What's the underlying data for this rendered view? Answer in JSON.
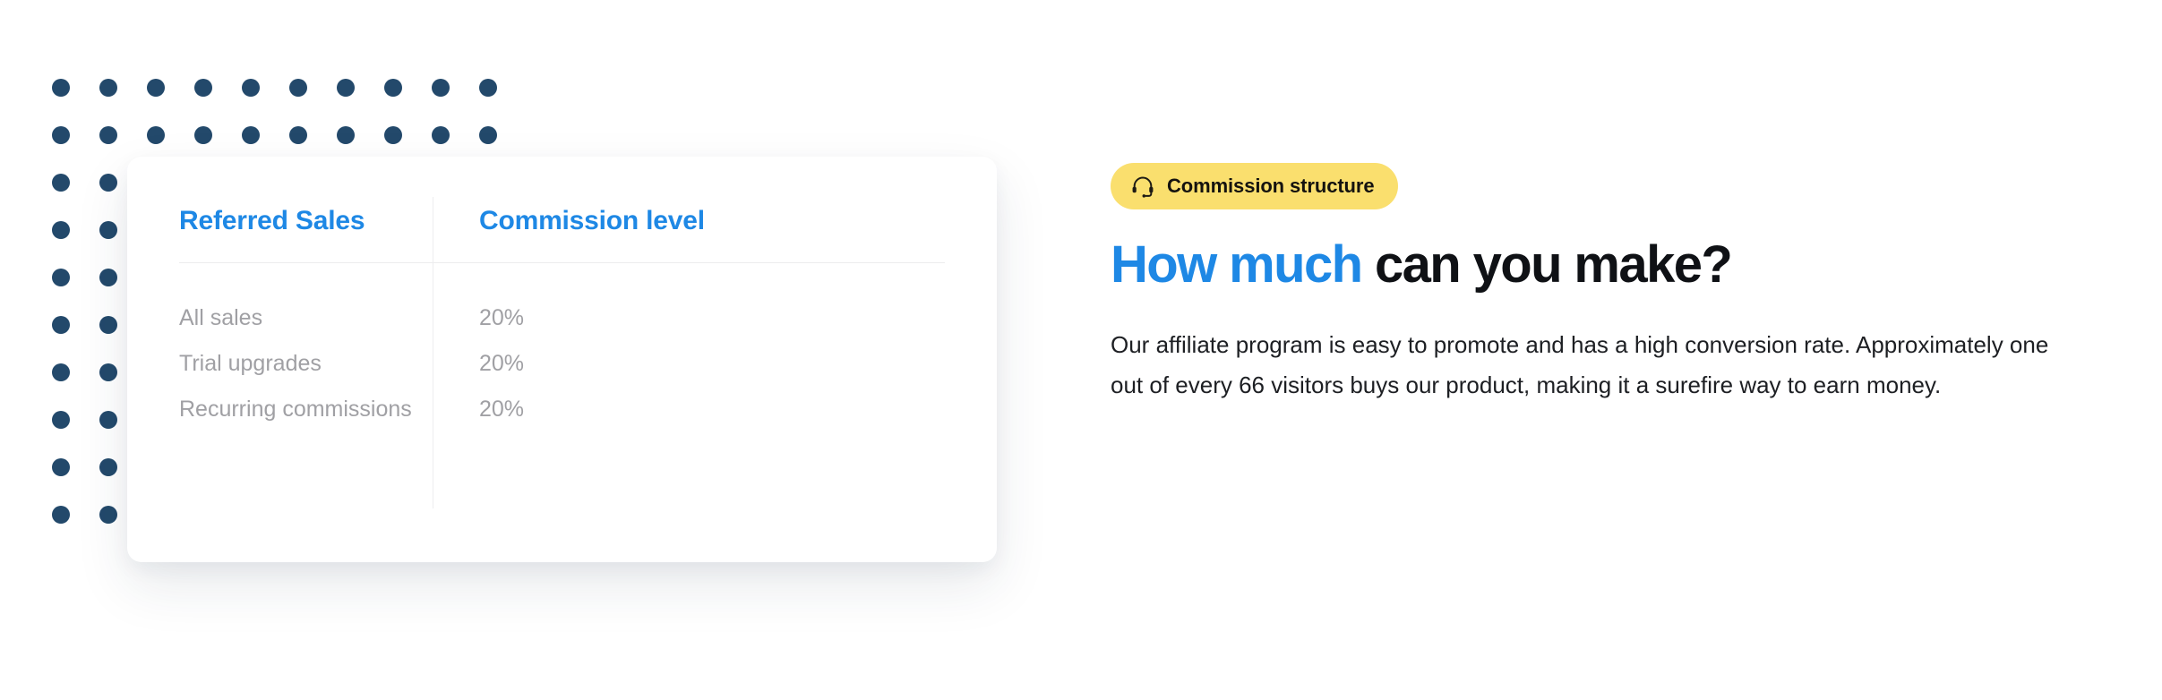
{
  "card": {
    "table": {
      "columns": [
        "Referred Sales",
        "Commission level"
      ],
      "rows": [
        {
          "label": "All sales",
          "value": "20%"
        },
        {
          "label": "Trial upgrades",
          "value": "20%"
        },
        {
          "label": "Recurring commissions",
          "value": "20%"
        }
      ]
    }
  },
  "content": {
    "badge": {
      "icon": "headset-icon",
      "label": "Commission structure"
    },
    "heading": {
      "accent": "How much",
      "rest": " can you make?"
    },
    "paragraph": "Our affiliate program is easy to promote and has a high conversion rate. Approximately one out of every 66 visitors buys our product, making it a surefire way to earn money."
  },
  "decor": {
    "dot_grid": {
      "columns": 10,
      "rows": 10,
      "color": "#23496b"
    }
  },
  "colors": {
    "accent_blue": "#1e88e5",
    "badge_yellow": "#fadf6e",
    "dot_navy": "#23496b",
    "muted_text": "#a0a0a4",
    "heading_dark": "#0f1115"
  }
}
